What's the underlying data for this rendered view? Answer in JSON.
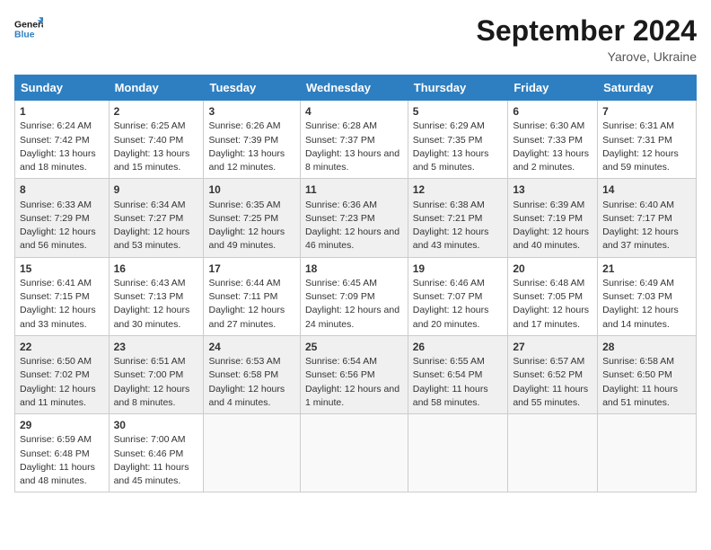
{
  "logo": {
    "line1": "General",
    "line2": "Blue"
  },
  "title": "September 2024",
  "location": "Yarove, Ukraine",
  "days_of_week": [
    "Sunday",
    "Monday",
    "Tuesday",
    "Wednesday",
    "Thursday",
    "Friday",
    "Saturday"
  ],
  "weeks": [
    [
      {
        "day": "1",
        "sunrise": "6:24 AM",
        "sunset": "7:42 PM",
        "daylight": "13 hours and 18 minutes."
      },
      {
        "day": "2",
        "sunrise": "6:25 AM",
        "sunset": "7:40 PM",
        "daylight": "13 hours and 15 minutes."
      },
      {
        "day": "3",
        "sunrise": "6:26 AM",
        "sunset": "7:39 PM",
        "daylight": "13 hours and 12 minutes."
      },
      {
        "day": "4",
        "sunrise": "6:28 AM",
        "sunset": "7:37 PM",
        "daylight": "13 hours and 8 minutes."
      },
      {
        "day": "5",
        "sunrise": "6:29 AM",
        "sunset": "7:35 PM",
        "daylight": "13 hours and 5 minutes."
      },
      {
        "day": "6",
        "sunrise": "6:30 AM",
        "sunset": "7:33 PM",
        "daylight": "13 hours and 2 minutes."
      },
      {
        "day": "7",
        "sunrise": "6:31 AM",
        "sunset": "7:31 PM",
        "daylight": "12 hours and 59 minutes."
      }
    ],
    [
      {
        "day": "8",
        "sunrise": "6:33 AM",
        "sunset": "7:29 PM",
        "daylight": "12 hours and 56 minutes."
      },
      {
        "day": "9",
        "sunrise": "6:34 AM",
        "sunset": "7:27 PM",
        "daylight": "12 hours and 53 minutes."
      },
      {
        "day": "10",
        "sunrise": "6:35 AM",
        "sunset": "7:25 PM",
        "daylight": "12 hours and 49 minutes."
      },
      {
        "day": "11",
        "sunrise": "6:36 AM",
        "sunset": "7:23 PM",
        "daylight": "12 hours and 46 minutes."
      },
      {
        "day": "12",
        "sunrise": "6:38 AM",
        "sunset": "7:21 PM",
        "daylight": "12 hours and 43 minutes."
      },
      {
        "day": "13",
        "sunrise": "6:39 AM",
        "sunset": "7:19 PM",
        "daylight": "12 hours and 40 minutes."
      },
      {
        "day": "14",
        "sunrise": "6:40 AM",
        "sunset": "7:17 PM",
        "daylight": "12 hours and 37 minutes."
      }
    ],
    [
      {
        "day": "15",
        "sunrise": "6:41 AM",
        "sunset": "7:15 PM",
        "daylight": "12 hours and 33 minutes."
      },
      {
        "day": "16",
        "sunrise": "6:43 AM",
        "sunset": "7:13 PM",
        "daylight": "12 hours and 30 minutes."
      },
      {
        "day": "17",
        "sunrise": "6:44 AM",
        "sunset": "7:11 PM",
        "daylight": "12 hours and 27 minutes."
      },
      {
        "day": "18",
        "sunrise": "6:45 AM",
        "sunset": "7:09 PM",
        "daylight": "12 hours and 24 minutes."
      },
      {
        "day": "19",
        "sunrise": "6:46 AM",
        "sunset": "7:07 PM",
        "daylight": "12 hours and 20 minutes."
      },
      {
        "day": "20",
        "sunrise": "6:48 AM",
        "sunset": "7:05 PM",
        "daylight": "12 hours and 17 minutes."
      },
      {
        "day": "21",
        "sunrise": "6:49 AM",
        "sunset": "7:03 PM",
        "daylight": "12 hours and 14 minutes."
      }
    ],
    [
      {
        "day": "22",
        "sunrise": "6:50 AM",
        "sunset": "7:02 PM",
        "daylight": "12 hours and 11 minutes."
      },
      {
        "day": "23",
        "sunrise": "6:51 AM",
        "sunset": "7:00 PM",
        "daylight": "12 hours and 8 minutes."
      },
      {
        "day": "24",
        "sunrise": "6:53 AM",
        "sunset": "6:58 PM",
        "daylight": "12 hours and 4 minutes."
      },
      {
        "day": "25",
        "sunrise": "6:54 AM",
        "sunset": "6:56 PM",
        "daylight": "12 hours and 1 minute."
      },
      {
        "day": "26",
        "sunrise": "6:55 AM",
        "sunset": "6:54 PM",
        "daylight": "11 hours and 58 minutes."
      },
      {
        "day": "27",
        "sunrise": "6:57 AM",
        "sunset": "6:52 PM",
        "daylight": "11 hours and 55 minutes."
      },
      {
        "day": "28",
        "sunrise": "6:58 AM",
        "sunset": "6:50 PM",
        "daylight": "11 hours and 51 minutes."
      }
    ],
    [
      {
        "day": "29",
        "sunrise": "6:59 AM",
        "sunset": "6:48 PM",
        "daylight": "11 hours and 48 minutes."
      },
      {
        "day": "30",
        "sunrise": "7:00 AM",
        "sunset": "6:46 PM",
        "daylight": "11 hours and 45 minutes."
      },
      null,
      null,
      null,
      null,
      null
    ]
  ],
  "labels": {
    "sunrise": "Sunrise:",
    "sunset": "Sunset:",
    "daylight": "Daylight:"
  }
}
